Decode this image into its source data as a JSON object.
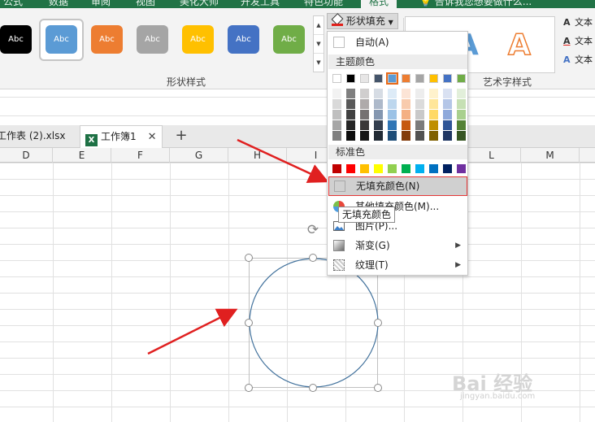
{
  "top_tabs": [
    "公式",
    "数据",
    "审阅",
    "视图",
    "美化大师",
    "开发工具",
    "特色功能",
    "格式"
  ],
  "tell_me": "告诉我您想要做什么...",
  "shape_styles": {
    "items": [
      {
        "label": "Abc",
        "color": "#000000"
      },
      {
        "label": "Abc",
        "color": "#5b9bd5"
      },
      {
        "label": "Abc",
        "color": "#ed7d31"
      },
      {
        "label": "Abc",
        "color": "#a5a5a5"
      },
      {
        "label": "Abc",
        "color": "#ffc000"
      },
      {
        "label": "Abc",
        "color": "#4472c4"
      },
      {
        "label": "Abc",
        "color": "#70ad47"
      }
    ],
    "group_label": "形状样式"
  },
  "shape_fill_button": "形状填充",
  "wordart": {
    "group_label": "艺术字样式",
    "letters": [
      {
        "label": "A",
        "color": "#5b9bd5"
      },
      {
        "label": "A",
        "color": "#ed7d31"
      }
    ],
    "text_commands": [
      "文本",
      "文本",
      "文本"
    ]
  },
  "workbook_tabs": {
    "inactive": "工作表 (2).xlsx",
    "active": "工作簿1",
    "xl_letter": "X",
    "close": "✕",
    "add": "+"
  },
  "columns": [
    "D",
    "E",
    "F",
    "G",
    "H",
    "I",
    "L",
    "M"
  ],
  "menu": {
    "auto": "自动(A)",
    "theme_header": "主题颜色",
    "theme_top": [
      "#ffffff",
      "#000000",
      "#e7e6e6",
      "#44546a",
      "#5b9bd5",
      "#ed7d31",
      "#a5a5a5",
      "#ffc000",
      "#4472c4",
      "#70ad47"
    ],
    "theme_shades": [
      [
        "#f2f2f2",
        "#7f7f7f",
        "#d0cece",
        "#d6dce4",
        "#ddebf7",
        "#fce4d6",
        "#ededed",
        "#fff2cc",
        "#d9e1f2",
        "#e2efda"
      ],
      [
        "#d9d9d9",
        "#595959",
        "#aeaaaa",
        "#adb9ca",
        "#bdd7ee",
        "#f8cbad",
        "#dbdbdb",
        "#ffe699",
        "#b4c6e7",
        "#c6e0b4"
      ],
      [
        "#bfbfbf",
        "#404040",
        "#757171",
        "#8497b0",
        "#9bc2e6",
        "#f4b084",
        "#c9c9c9",
        "#ffd966",
        "#8ea9db",
        "#a9d08e"
      ],
      [
        "#a6a6a6",
        "#262626",
        "#3a3838",
        "#333f4f",
        "#2f75b5",
        "#c65911",
        "#7b7b7b",
        "#bf8f00",
        "#2f5597",
        "#548235"
      ],
      [
        "#808080",
        "#0d0d0d",
        "#161616",
        "#222b35",
        "#1f4e78",
        "#833c0b",
        "#525252",
        "#7f6000",
        "#203764",
        "#375623"
      ]
    ],
    "standard_header": "标准色",
    "standard": [
      "#c00000",
      "#ff0000",
      "#ffc000",
      "#ffff00",
      "#92d050",
      "#00b050",
      "#00b0f0",
      "#0070c0",
      "#002060",
      "#7030a0"
    ],
    "no_fill": "无填充颜色(N)",
    "more_colors": "其他填充颜色(M)...",
    "picture": "图片(P)...",
    "gradient": "渐变(G)",
    "texture": "纹理(T)",
    "submenu_arrow": "▶"
  },
  "tooltip": "无填充颜色",
  "rotate_icon": "⟳",
  "watermark": {
    "main": "Bai 经验",
    "url": "jingyan.baidu.com"
  }
}
